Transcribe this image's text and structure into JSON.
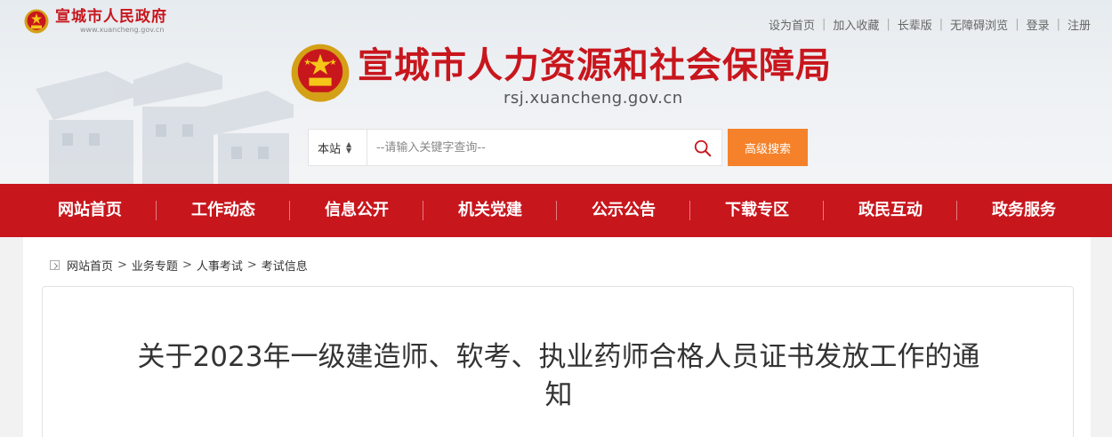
{
  "top_logo": {
    "name": "宣城市人民政府",
    "url": "www.xuancheng.gov.cn"
  },
  "top_links": [
    "设为首页",
    "加入收藏",
    "长辈版",
    "无障碍浏览",
    "登录",
    "注册"
  ],
  "brand": {
    "title": "宣城市人力资源和社会保障局",
    "url": "rsj.xuancheng.gov.cn"
  },
  "search": {
    "scope": "本站",
    "placeholder": "--请输入关键字查询--",
    "advanced_label": "高级搜索"
  },
  "nav": [
    "网站首页",
    "工作动态",
    "信息公开",
    "机关党建",
    "公示公告",
    "下载专区",
    "政民互动",
    "政务服务"
  ],
  "breadcrumb": [
    "网站首页",
    "业务专题",
    "人事考试",
    "考试信息"
  ],
  "article": {
    "title": "关于2023年一级建造师、软考、执业药师合格人员证书发放工作的通知"
  },
  "colors": {
    "brand_red": "#c8161d",
    "accent_orange": "#f5822a"
  }
}
